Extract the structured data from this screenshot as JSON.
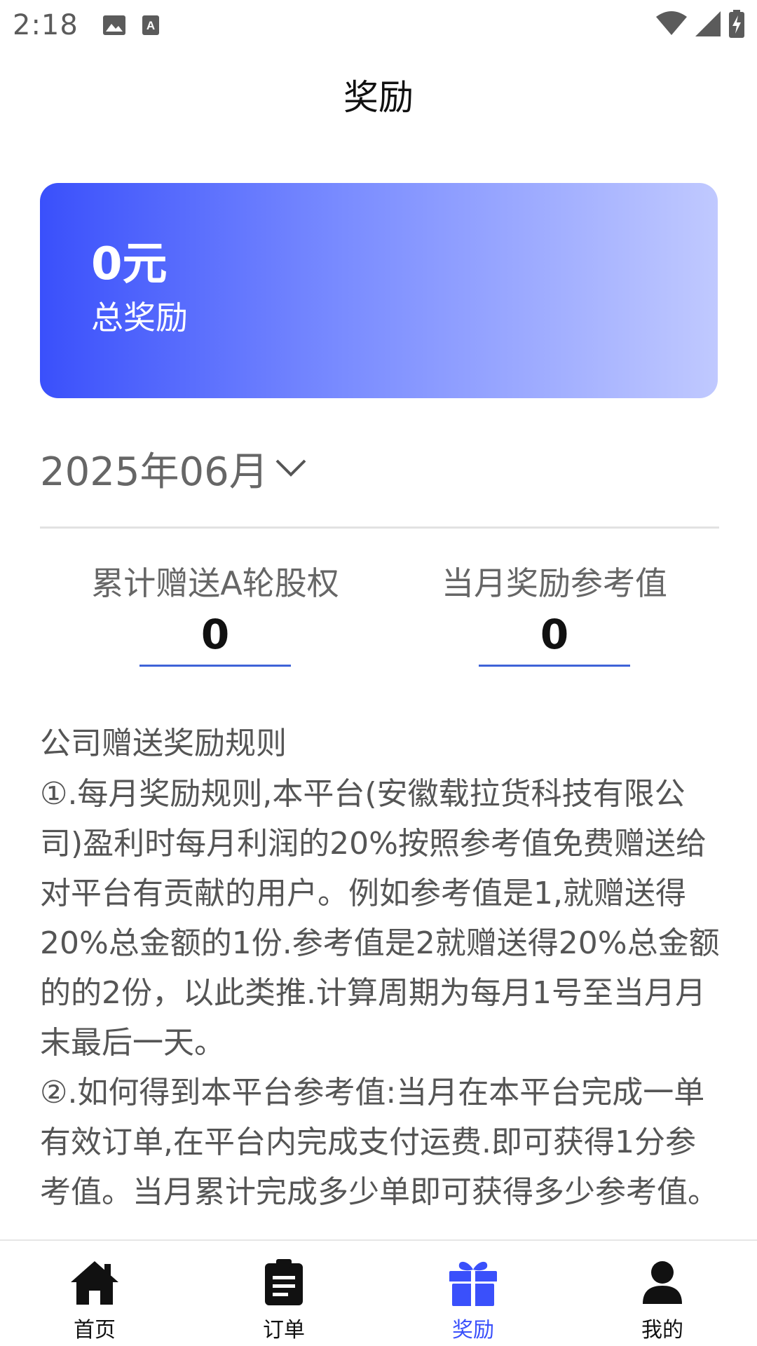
{
  "status_bar": {
    "time": "2:18"
  },
  "header": {
    "title": "奖励"
  },
  "summary": {
    "amount": "0元",
    "label": "总奖励"
  },
  "month_selector": {
    "value": "2025年06月"
  },
  "stats": [
    {
      "label": "累计赠送A轮股权",
      "value": "0"
    },
    {
      "label": "当月奖励参考值",
      "value": "0"
    }
  ],
  "rules": {
    "title": "公司赠送奖励规则",
    "rule_1": "①.每月奖励规则,本平台(安徽载拉货科技有限公司)盈利时每月利润的20%按照参考值免费赠送给对平台有贡献的用户。例如参考值是1,就赠送得20%总金额的1份.参考值是2就赠送得20%总金额的的2份，以此类推.计算周期为每月1号至当月月末最后一天。",
    "rule_2": "②.如何得到本平台参考值:当月在本平台完成一单有效订单,在平台内完成支付运费.即可获得1分参考值。当月累计完成多少单即可获得多少参考值。"
  },
  "bottom_nav": [
    {
      "label": "首页",
      "icon": "home-icon",
      "active": false
    },
    {
      "label": "订单",
      "icon": "order-clipboard-icon",
      "active": false
    },
    {
      "label": "奖励",
      "icon": "gift-icon",
      "active": true
    },
    {
      "label": "我的",
      "icon": "user-icon",
      "active": false
    }
  ],
  "colors": {
    "accent": "#3a50fb",
    "card_gradient_start": "#3a50fb",
    "card_gradient_end": "#c0c9ff",
    "underline": "#3e63d8"
  }
}
